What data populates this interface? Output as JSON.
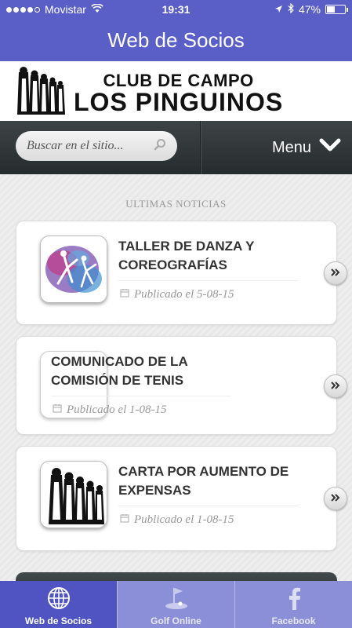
{
  "status_bar": {
    "carrier": "Movistar",
    "time": "19:31",
    "battery_percent": "47%",
    "battery_level": 0.47,
    "signal_bars_filled": 4,
    "signal_bars_total": 5
  },
  "nav": {
    "title": "Web de Socios"
  },
  "logo": {
    "line1": "CLUB DE CAMPO",
    "line2": "LOS PINGUINOS"
  },
  "search": {
    "placeholder": "Buscar en el sitio...",
    "menu_label": "Menu"
  },
  "news": {
    "heading": "ULTIMAS NOTICIAS",
    "items": [
      {
        "title": "TALLER DE DANZA Y COREOGRAFÍAS",
        "date": "Publicado el 5-08-15",
        "image": "dance-image"
      },
      {
        "title": "COMUNICADO DE LA COMISIÓN DE TENIS",
        "date": "Publicado el 1-08-15",
        "image": "none"
      },
      {
        "title": "CARTA POR AUMENTO DE EXPENSAS",
        "date": "Publicado el 1-08-15",
        "image": "penguins-logo"
      }
    ]
  },
  "tabs": [
    {
      "label": "Web de Socios",
      "icon": "globe-icon",
      "active": true
    },
    {
      "label": "Golf Online",
      "icon": "golf-flag-icon",
      "active": false
    },
    {
      "label": "Facebook",
      "icon": "facebook-icon",
      "active": false
    }
  ],
  "colors": {
    "header": "#5a5fc8",
    "tab_active": "#4f54c2",
    "tab_inactive": "#8a8fd8",
    "search_bar": "#2e3436"
  }
}
